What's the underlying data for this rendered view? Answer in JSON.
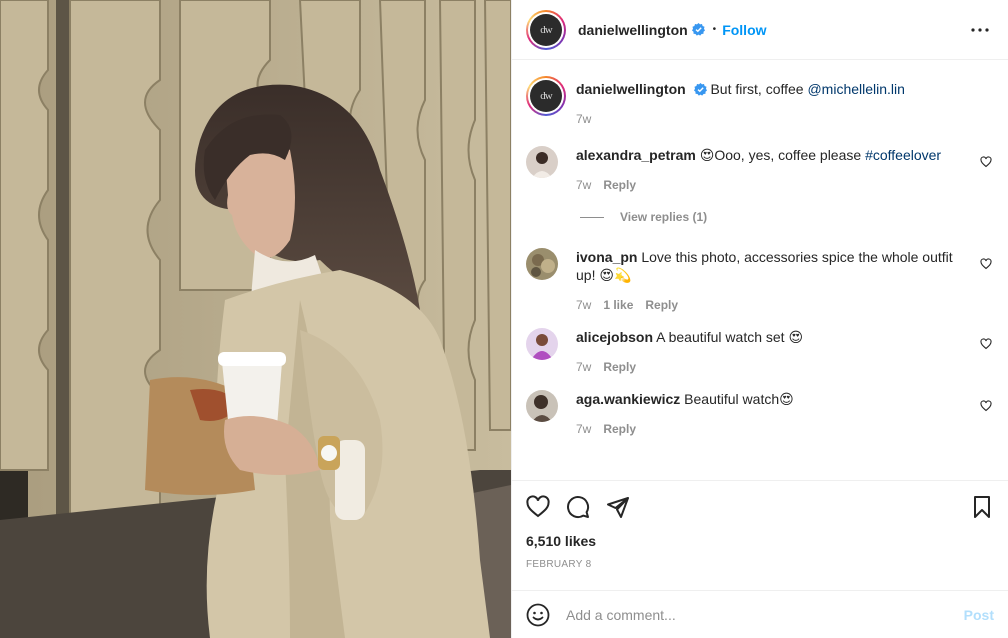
{
  "post": {
    "author": "danielwellington",
    "avatar_text": "dw",
    "follow_label": "Follow",
    "separator": "•",
    "caption": "But first, coffee",
    "caption_mention": "@michellelin.lin",
    "caption_time": "7w",
    "likes": "6,510 likes",
    "date": "FEBRUARY 8"
  },
  "comments": [
    {
      "user": "alexandra_petram",
      "text_before": "😍Ooo, yes, coffee please ",
      "tag": "#coffeelover",
      "time": "7w",
      "likes": "",
      "reply": "Reply",
      "avatar_color": "#d9cfc8",
      "view_replies": "View replies (1)"
    },
    {
      "user": "ivona_pn",
      "text_before": "Love this photo, accessories spice the whole outfit up! 😍💫",
      "tag": "",
      "time": "7w",
      "likes": "1 like",
      "reply": "Reply",
      "avatar_color": "#9a8e6d"
    },
    {
      "user": "alicejobson",
      "text_before": "A beautiful watch set 😍",
      "tag": "",
      "time": "7w",
      "likes": "",
      "reply": "Reply",
      "avatar_color": "#b04fc0"
    },
    {
      "user": "aga.wankiewicz",
      "text_before": "Beautiful watch😍",
      "tag": "",
      "time": "7w",
      "likes": "",
      "reply": "Reply",
      "avatar_color": "#5b4c42"
    }
  ],
  "add_comment": {
    "placeholder": "Add a comment...",
    "post_label": "Post"
  },
  "icons": {
    "more": "more-options-icon",
    "like": "heart-icon",
    "comment": "comment-icon",
    "share": "share-icon",
    "save": "bookmark-icon",
    "emoji": "emoji-icon",
    "verified": "verified-badge-icon"
  },
  "colors": {
    "accent": "#0095f6",
    "link": "#00376b",
    "muted": "#8e8e8e",
    "post_disabled": "#b2dffc"
  }
}
